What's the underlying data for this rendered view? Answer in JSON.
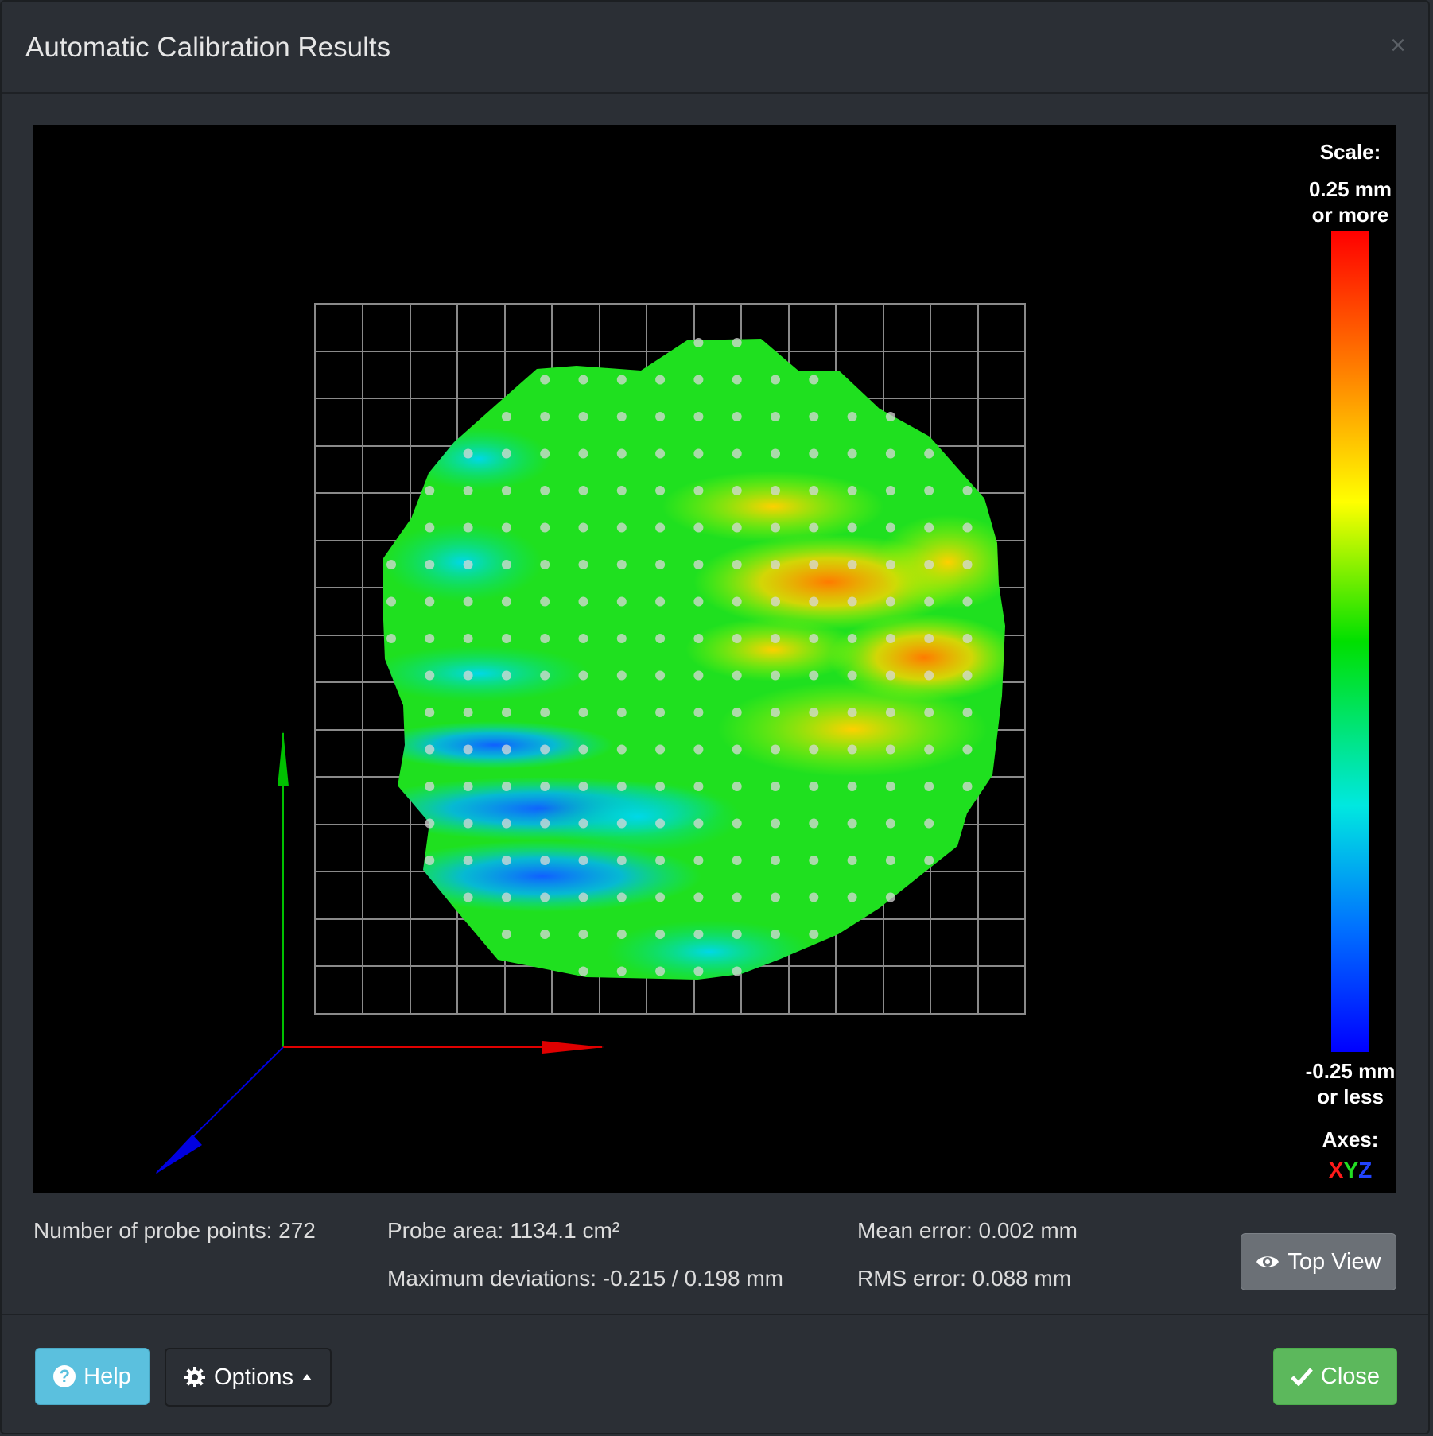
{
  "dialog": {
    "title": "Automatic Calibration Results",
    "close_glyph": "×"
  },
  "legend": {
    "scale_label": "Scale:",
    "max_line1": "0.25 mm",
    "max_line2": "or more",
    "min_line1": "-0.25 mm",
    "min_line2": "or less",
    "axes_label": "Axes:",
    "axis_x": "X",
    "axis_y": "Y",
    "axis_z": "Z",
    "colors": [
      "#ff0000",
      "#ff8000",
      "#ffff00",
      "#00e000",
      "#00e8e0",
      "#0070ff",
      "#0000ff"
    ]
  },
  "stats": {
    "probe_points": "Number of probe points: 272",
    "probe_area": "Probe area: 1134.1 cm²",
    "max_deviation": "Maximum deviations: -0.215 / 0.198 mm",
    "mean_error": "Mean error: 0.002 mm",
    "rms_error": "RMS error: 0.088 mm"
  },
  "buttons": {
    "top_view": "Top View",
    "help": "Help",
    "options": "Options",
    "close": "Close"
  },
  "icons": {
    "top_view": "eye-icon",
    "help": "question-circle-icon",
    "options": "gear-icon",
    "close": "check-icon"
  }
}
